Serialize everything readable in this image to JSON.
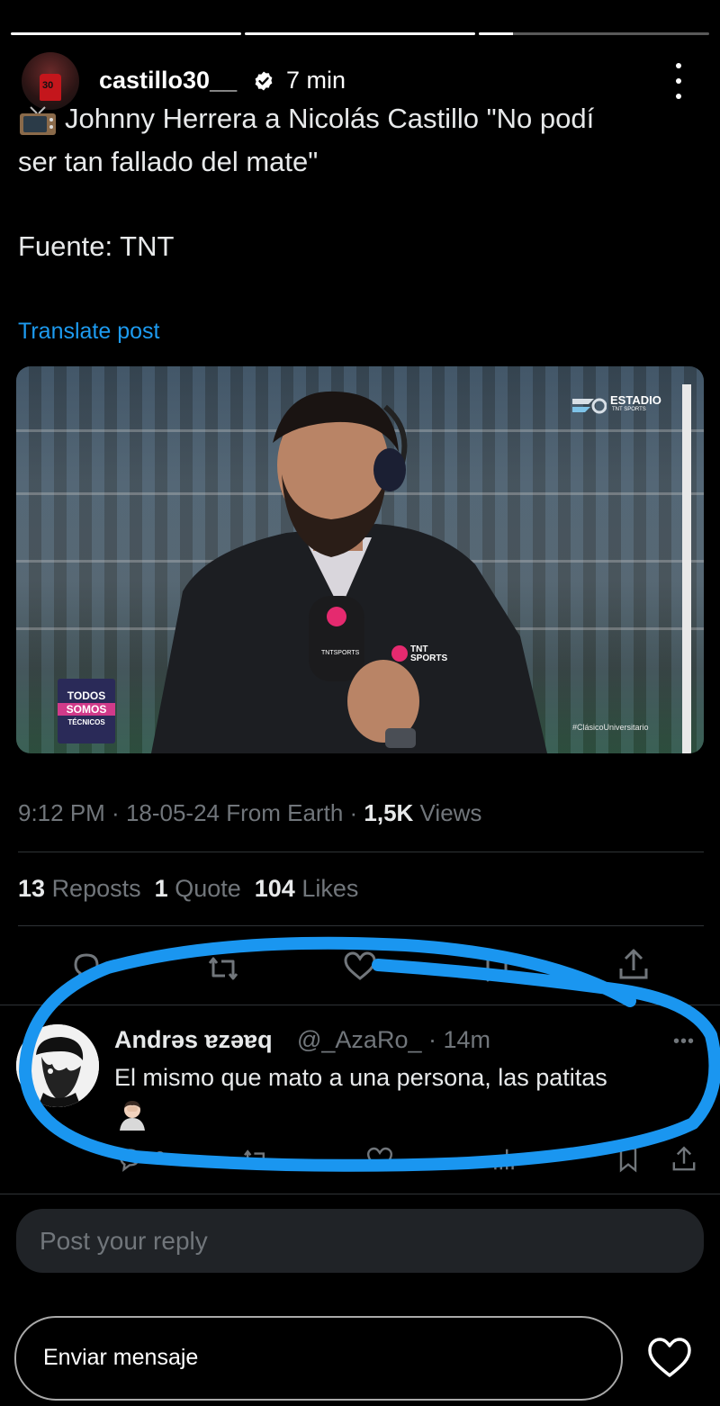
{
  "story": {
    "progress": [
      1,
      1,
      0.15
    ]
  },
  "header": {
    "username": "castillo30__",
    "time": "7 min",
    "avatar_number": "30"
  },
  "post": {
    "line1": "Johnny Herrera a Nicolás Castillo \"No podí",
    "line2": "ser tan fallado del mate\"",
    "source": "Fuente: TNT",
    "translate_label": "Translate post",
    "media": {
      "estadio_logo": "ESTADIO",
      "estadio_sub": "TNT SPORTS",
      "tnt_logo": "TNT SPORTS",
      "todos": "TODOS",
      "somos": "SOMOS",
      "tecnicos": "TÉCNICOS",
      "hashtag": "#ClásicoUniversitario"
    },
    "meta": {
      "time": "9:12 PM",
      "date": "18-05-24",
      "location": "From Earth",
      "views_count": "1,5K",
      "views_label": "Views"
    },
    "stats": {
      "reposts_count": "13",
      "reposts_label": "Reposts",
      "quotes_count": "1",
      "quotes_label": "Quote",
      "likes_count": "104",
      "likes_label": "Likes"
    }
  },
  "reply": {
    "name": "Andrəs ɐzəɐq",
    "handle": "@_AzaRo_",
    "time": "14m",
    "text": "El mismo que mato a una persona, las patitas",
    "reply_count": "2",
    "emoji": "facepalm-emoji"
  },
  "reply_box": {
    "placeholder": "Post your reply"
  },
  "story_reply": {
    "placeholder": "Enviar mensaje"
  },
  "colors": {
    "background": "#000000",
    "link": "#1d9bf0",
    "muted": "#71767b",
    "annotation": "#1a96f0"
  }
}
